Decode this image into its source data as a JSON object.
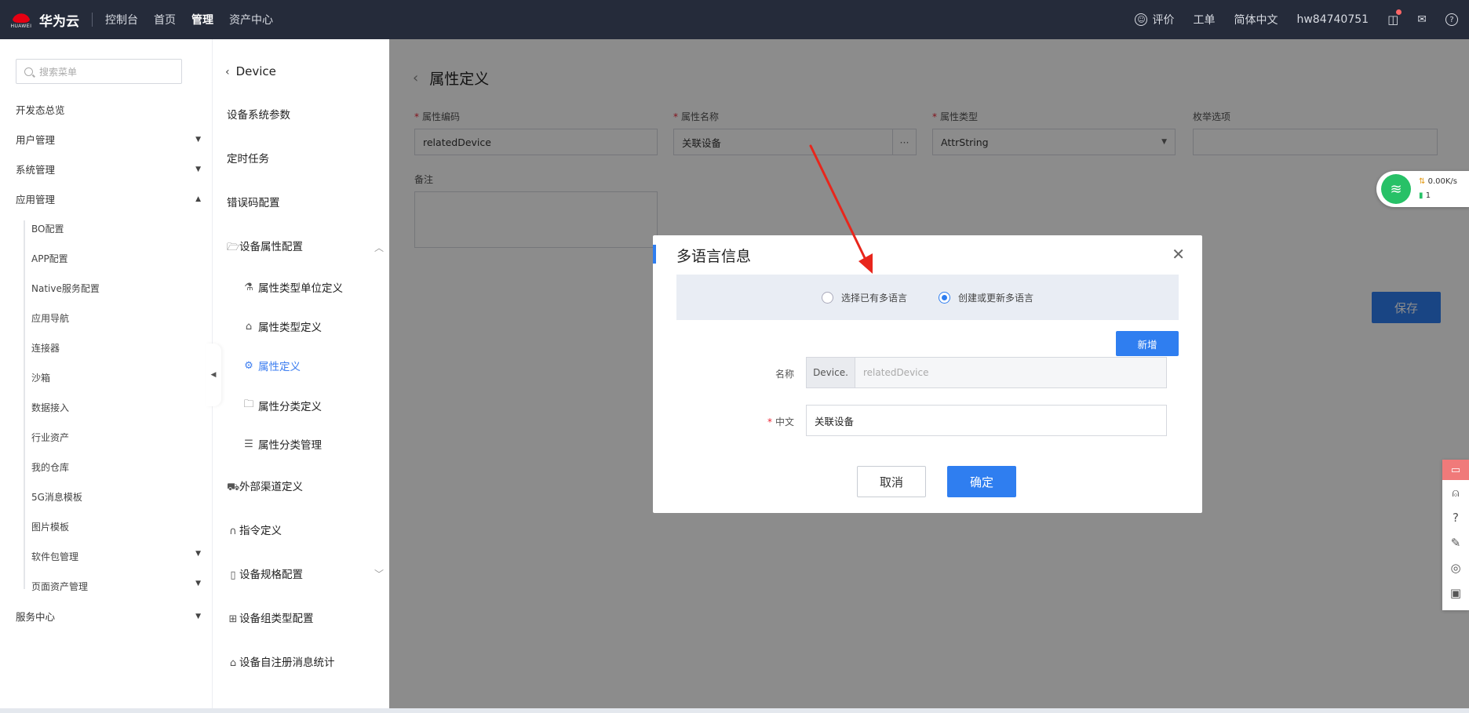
{
  "topbar": {
    "logo_word": "HUAWEI",
    "brand": "华为云",
    "nav": [
      "控制台",
      "首页",
      "管理",
      "资产中心"
    ],
    "active_nav": "管理",
    "rate": "评价",
    "ticket": "工单",
    "lang": "简体中文",
    "user": "hw84740751"
  },
  "sidebar1": {
    "search_placeholder": "搜索菜单",
    "overview": "开发态总览",
    "user_mgmt": "用户管理",
    "system_mgmt": "系统管理",
    "app_mgmt": "应用管理",
    "sub": [
      "BO配置",
      "APP配置",
      "Native服务配置",
      "应用导航",
      "连接器",
      "沙箱",
      "数据接入",
      "行业资产",
      "我的仓库",
      "5G消息模板",
      "图片模板"
    ],
    "pkg_mgmt": "软件包管理",
    "page_asset_mgmt": "页面资产管理",
    "service_center": "服务中心"
  },
  "sidebar2": {
    "back": "Device",
    "items": [
      "设备系统参数",
      "定时任务",
      "错误码配置"
    ],
    "attr_config": "设备属性配置",
    "attr_sub": [
      "属性类型单位定义",
      "属性类型定义",
      "属性定义",
      "属性分类定义",
      "属性分类管理"
    ],
    "active_sub": "属性定义",
    "channel": "外部渠道定义",
    "command": "指令定义",
    "spec": "设备规格配置",
    "group": "设备组类型配置",
    "selfreg": "设备自注册消息统计"
  },
  "main": {
    "title": "属性定义",
    "code_label": "属性编码",
    "code_value": "relatedDevice",
    "name_label": "属性名称",
    "name_value": "关联设备",
    "name_more": "···",
    "type_label": "属性类型",
    "type_value": "AttrString",
    "enum_label": "枚举选项",
    "remark_label": "备注",
    "save": "保存"
  },
  "modal": {
    "title": "多语言信息",
    "radio_existing": "选择已有多语言",
    "radio_create": "创建或更新多语言",
    "add": "新增",
    "name_label": "名称",
    "name_prefix": "Device.",
    "name_value": "relatedDevice",
    "zh_label": "中文",
    "zh_value": "关联设备",
    "cancel": "取消",
    "ok": "确定"
  },
  "network": {
    "speed": "0.00K/s",
    "count": "1"
  },
  "colors": {
    "primary": "#2f7ef0",
    "topbar": "#252b3a",
    "annotation_arrow": "#e8261c"
  }
}
